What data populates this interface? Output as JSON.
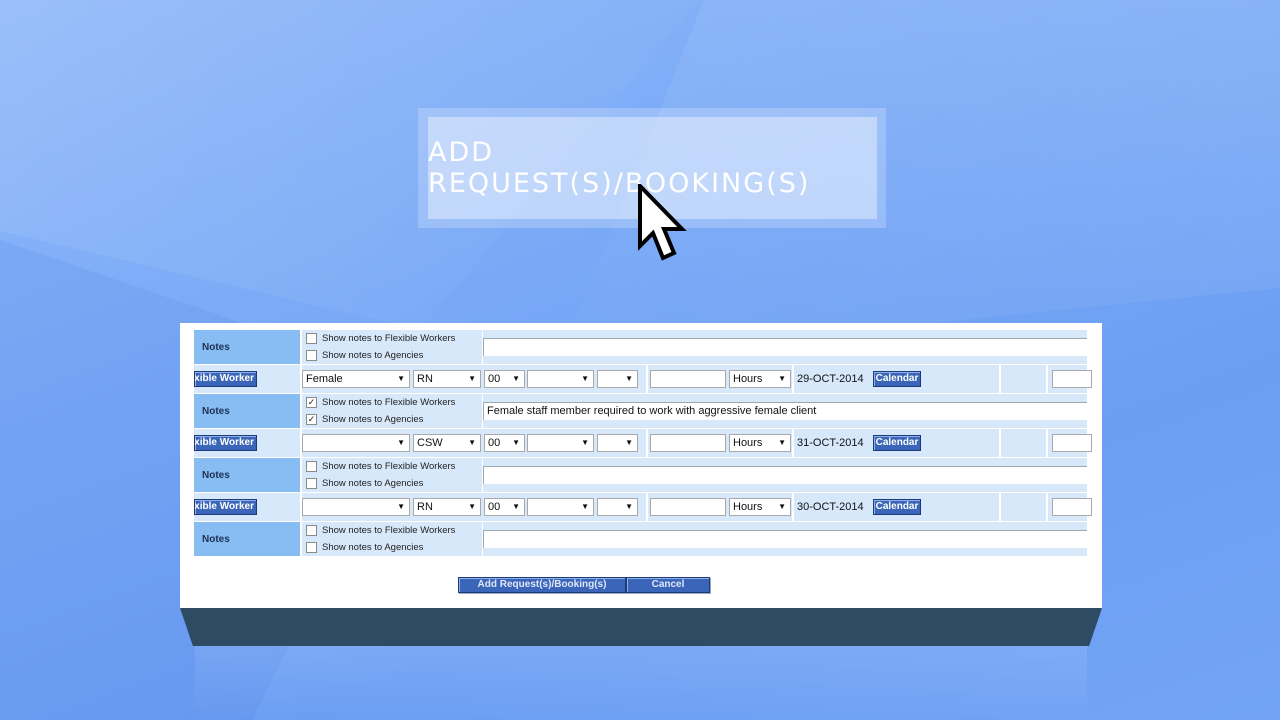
{
  "title_button": {
    "label": "ADD REQUEST(S)/BOOKING(S)"
  },
  "colors": {
    "accent": "#3b65b8",
    "row_bg": "#d7e8fb",
    "label_bg": "#88bdf3",
    "base": "#2f4a63"
  },
  "notes_sections": [
    {
      "label": "Notes",
      "show_flexible": {
        "label": "Show notes to Flexible Workers",
        "checked": false
      },
      "show_agencies": {
        "label": "Show notes to Agencies",
        "checked": false
      },
      "text": ""
    },
    {
      "label": "Notes",
      "show_flexible": {
        "label": "Show notes to Flexible Workers",
        "checked": true
      },
      "show_agencies": {
        "label": "Show notes to Agencies",
        "checked": true
      },
      "text": "Female staff member required to work with aggressive female client"
    },
    {
      "label": "Notes",
      "show_flexible": {
        "label": "Show notes to Flexible Workers",
        "checked": false
      },
      "show_agencies": {
        "label": "Show notes to Agencies",
        "checked": false
      },
      "text": ""
    },
    {
      "label": "Notes",
      "show_flexible": {
        "label": "Show notes to Flexible Workers",
        "checked": false
      },
      "show_agencies": {
        "label": "Show notes to Agencies",
        "checked": false
      },
      "text": ""
    }
  ],
  "booking_rows": [
    {
      "worker_button": "Flexible Worker",
      "gender": "Female",
      "grade": "RN",
      "minutes": "00",
      "unit": "Hours",
      "date": "29-OCT-2014",
      "calendar": "Calendar"
    },
    {
      "worker_button": "Flexible Worker",
      "gender": "",
      "grade": "CSW",
      "minutes": "00",
      "unit": "Hours",
      "date": "31-OCT-2014",
      "calendar": "Calendar"
    },
    {
      "worker_button": "Flexible Worker",
      "gender": "",
      "grade": "RN",
      "minutes": "00",
      "unit": "Hours",
      "date": "30-OCT-2014",
      "calendar": "Calendar"
    }
  ],
  "actions": {
    "add_label": "Add Request(s)/Booking(s)",
    "cancel_label": "Cancel"
  },
  "icons": {
    "cursor": "arrow-cursor-icon",
    "checkmark": "✓",
    "dropdown": "▼"
  }
}
